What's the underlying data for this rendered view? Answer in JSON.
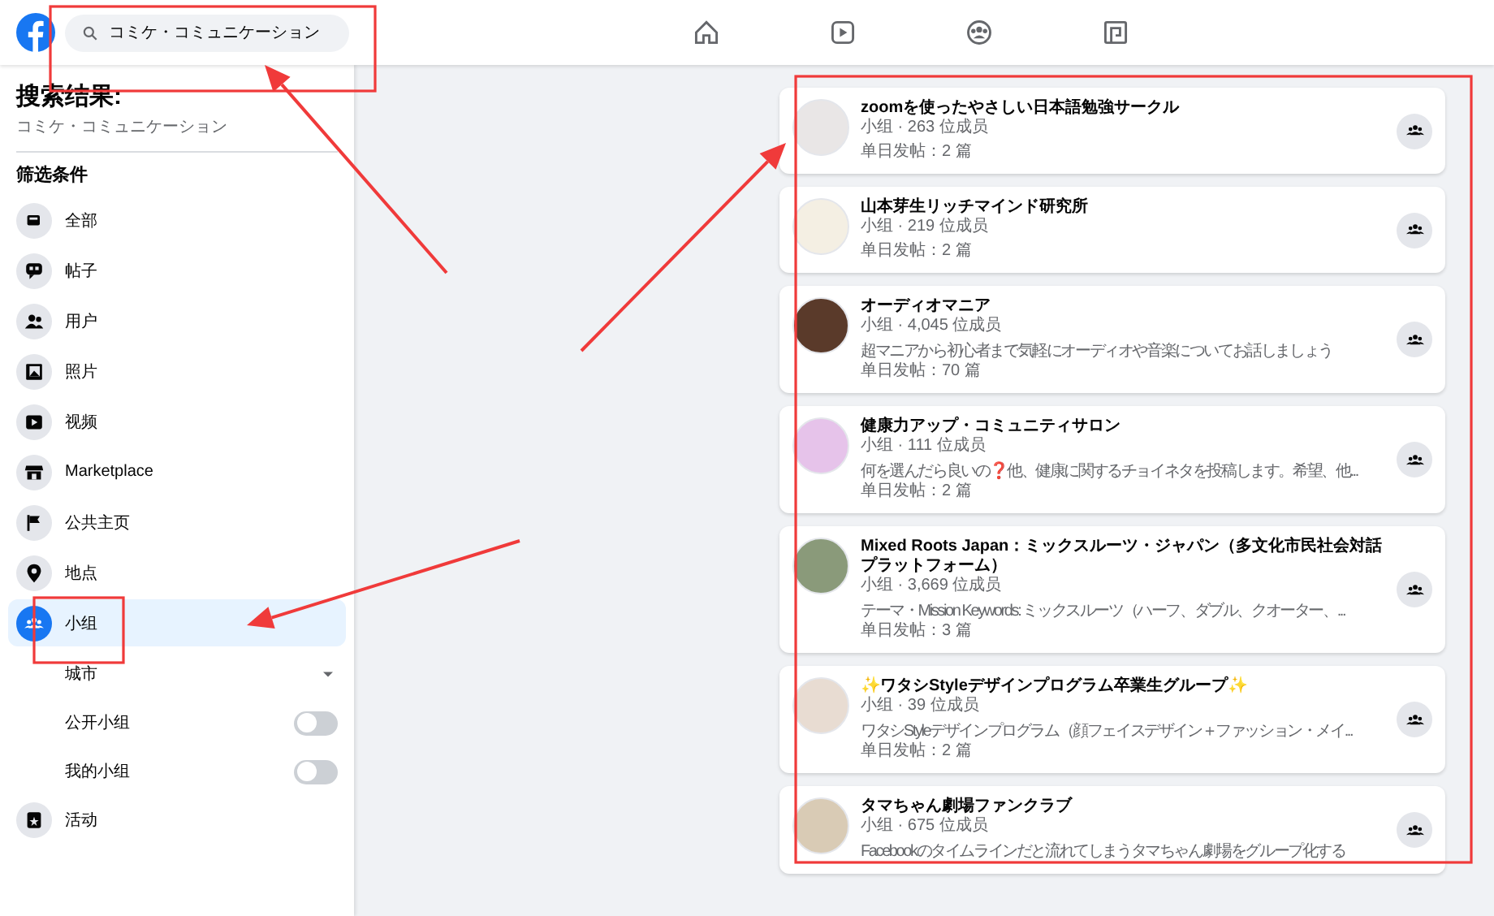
{
  "header": {
    "search": {
      "value": "コミケ・コミュニケーション"
    },
    "nav": [
      {
        "selected": false
      },
      {
        "selected": false
      },
      {
        "selected": false
      },
      {
        "selected": false
      }
    ]
  },
  "sidebar": {
    "title": "搜索结果:",
    "query": "コミケ・コミュニケーション",
    "filters_heading": "筛选条件",
    "filters": [
      {
        "label": "全部",
        "selected": false
      },
      {
        "label": "帖子",
        "selected": false
      },
      {
        "label": "用户",
        "selected": false
      },
      {
        "label": "照片",
        "selected": false
      },
      {
        "label": "视频",
        "selected": false
      },
      {
        "label": "Marketplace",
        "selected": false
      },
      {
        "label": "公共主页",
        "selected": false
      },
      {
        "label": "地点",
        "selected": false
      },
      {
        "label": "小组",
        "selected": true,
        "options": [
          {
            "kind": "dropdown",
            "label": "城市"
          },
          {
            "kind": "toggle",
            "label": "公开小组",
            "on": false
          },
          {
            "kind": "toggle",
            "label": "我的小组",
            "on": false
          }
        ]
      },
      {
        "label": "活动",
        "selected": false
      }
    ]
  },
  "results": [
    {
      "name": "zoomを使ったやさしい日本語勉強サークル",
      "meta": "小组 · 263 位成员",
      "posts": "单日发帖：2 篇"
    },
    {
      "name": "山本芽生リッチマインド研究所",
      "meta": "小组 · 219 位成员",
      "posts": "单日发帖：2 篇"
    },
    {
      "name": "オーディオマニア",
      "meta": "小组 · 4,045 位成员",
      "description": "超マニアから初心者まで気軽にオーディオや音楽についてお話しましょう",
      "posts": "单日发帖：70 篇"
    },
    {
      "name": "健康力アップ・コミュニティサロン",
      "meta": "小组 · 111 位成员",
      "description": "何を選んだら良いの❓他、健康に関するチョイネタを投稿します。希望、他...",
      "posts": "单日发帖：2 篇"
    },
    {
      "name": "Mixed Roots Japan：ミックスルーツ・ジャパン（多文化市民社会対話プラットフォーム）",
      "meta": "小组 · 3,669 位成员",
      "description": "テーマ・Mission Keywords: ミックスルーツ（ハーフ、ダブル、クオーター、...",
      "posts": "单日发帖：3 篇"
    },
    {
      "name": "✨ワタシStyleデザインプログラム卒業生グループ✨",
      "meta": "小组 · 39 位成员",
      "description": "ワタシStyleデザインプログラム（顔フェイスデザイン＋ファッション・メイ...",
      "posts": "单日发帖：2 篇"
    },
    {
      "name": "タマちゃん劇場ファンクラブ",
      "meta": "小组 · 675 位成员",
      "description": "Facebookのタイムラインだと流れてしまうタマちゃん劇場をグループ化する"
    }
  ]
}
